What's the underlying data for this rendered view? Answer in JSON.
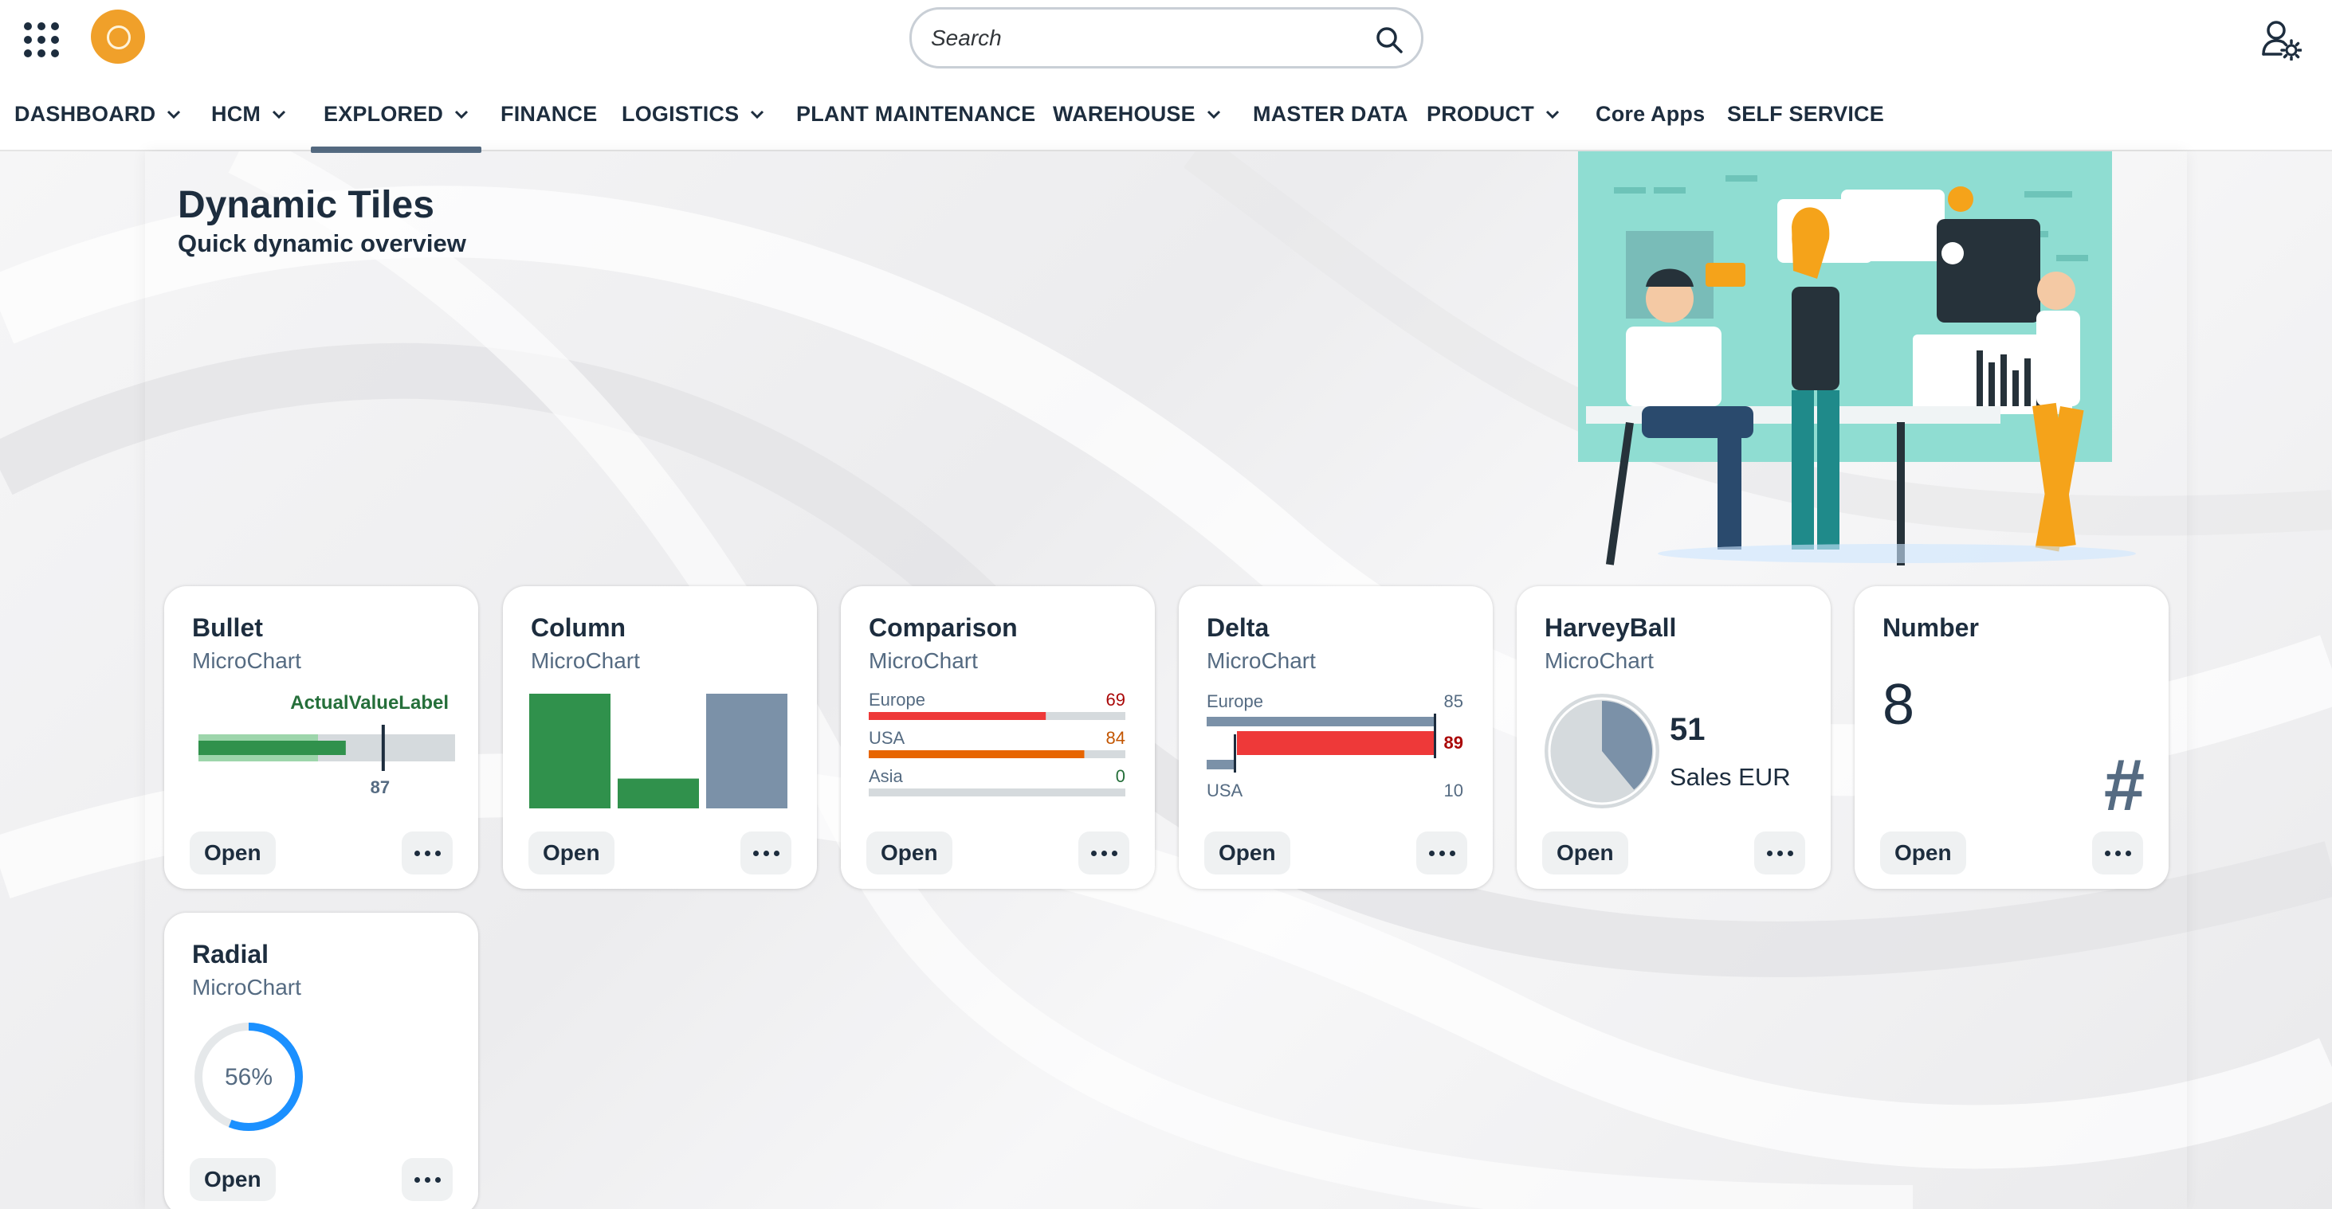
{
  "shell": {
    "search_placeholder": "Search"
  },
  "nav": {
    "items": [
      {
        "label": "DASHBOARD",
        "dropdown": true
      },
      {
        "label": "HCM",
        "dropdown": true
      },
      {
        "label": "EXPLORED",
        "dropdown": true,
        "active": true
      },
      {
        "label": "FINANCE",
        "dropdown": false
      },
      {
        "label": "LOGISTICS",
        "dropdown": true
      },
      {
        "label": "PLANT MAINTENANCE",
        "dropdown": false
      },
      {
        "label": "WAREHOUSE",
        "dropdown": true
      },
      {
        "label": "MASTER DATA",
        "dropdown": false
      },
      {
        "label": "PRODUCT",
        "dropdown": true
      },
      {
        "label": "Core Apps",
        "dropdown": false
      },
      {
        "label": "SELF SERVICE",
        "dropdown": false
      }
    ]
  },
  "page": {
    "title": "Dynamic Tiles",
    "subtitle": "Quick dynamic overview"
  },
  "tiles": {
    "bullet": {
      "title": "Bullet",
      "subtitle": "MicroChart",
      "actual_label": "ActualValueLabel",
      "target_label": "87",
      "actual_fraction": 0.7,
      "target_fraction": 0.72,
      "open": "Open"
    },
    "column": {
      "title": "Column",
      "subtitle": "MicroChart",
      "open": "Open"
    },
    "comparison": {
      "title": "Comparison",
      "subtitle": "MicroChart",
      "open": "Open"
    },
    "delta": {
      "title": "Delta",
      "subtitle": "MicroChart",
      "label1": "Europe",
      "value1": "85",
      "delta_value": "89",
      "label2": "USA",
      "value2": "10",
      "open": "Open"
    },
    "harvey": {
      "title": "HarveyBall",
      "subtitle": "MicroChart",
      "value": "51",
      "unit": "Sales EUR",
      "fraction": 0.39,
      "open": "Open"
    },
    "number": {
      "title": "Number",
      "subtitle": "",
      "value": "8",
      "icon": "#",
      "open": "Open"
    },
    "radial": {
      "title": "Radial",
      "subtitle": "MicroChart",
      "percent_label": "56%",
      "percent": 56,
      "open": "Open"
    }
  },
  "chart_data": [
    {
      "type": "bar",
      "name": "column-microchart",
      "values": [
        100,
        26,
        100
      ],
      "colors": [
        "#30914c",
        "#30914c",
        "#7b91a8"
      ]
    },
    {
      "type": "bar",
      "name": "comparison-microchart",
      "categories": [
        "Europe",
        "USA",
        "Asia"
      ],
      "values": [
        69,
        84,
        0
      ],
      "colors": [
        "#ee3939",
        "#e76500",
        "#256f3a"
      ],
      "max": 100
    }
  ],
  "colors": {
    "accent": "#0070f2",
    "positive": "#30914c",
    "critical": "#e76500",
    "negative": "#ee3939",
    "neutral": "#7b91a8",
    "logo": "#f0a02a"
  }
}
